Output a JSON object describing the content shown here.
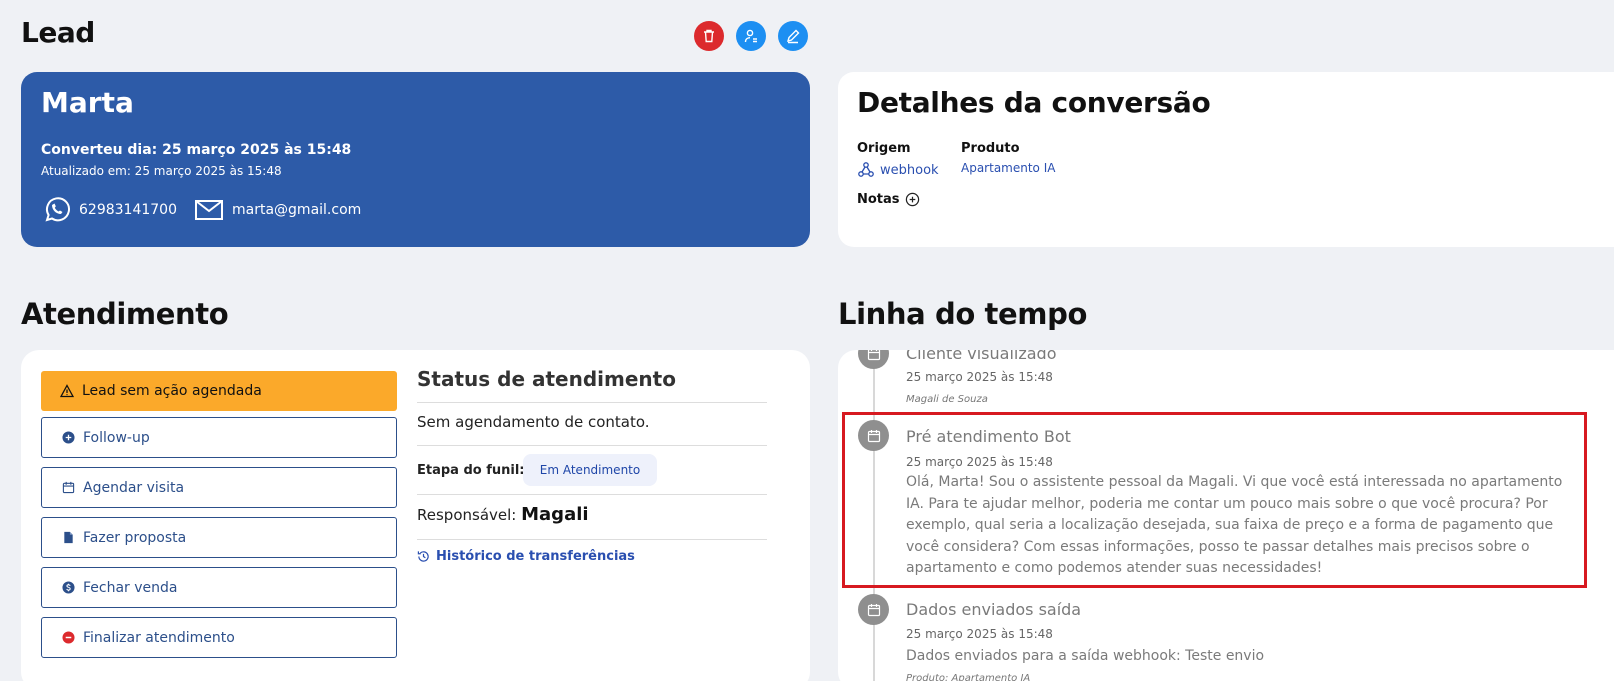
{
  "page": {
    "title": "Lead"
  },
  "header_actions": {
    "icons": [
      "trash-icon",
      "user-assign-icon",
      "pencil-icon"
    ],
    "colors": {
      "delete": "#dc2a2d",
      "primary": "#1d8ff2"
    }
  },
  "lead": {
    "name": "Marta",
    "converted": "Converteu dia: 25 março 2025 às 15:48",
    "updated": "Atualizado em: 25 março 2025 às 15:48",
    "phone": "62983141700",
    "email": "marta@gmail.com",
    "card_color": "#2d5ba8"
  },
  "details": {
    "title": "Detalhes da conversão",
    "origem_label": "Origem",
    "origem_value": "webhook",
    "produto_label": "Produto",
    "produto_value": "Apartamento IA",
    "notas_label": "Notas"
  },
  "atendimento": {
    "title": "Atendimento",
    "alert": "Lead sem ação agendada",
    "actions": [
      {
        "label": "Follow-up",
        "icon": "plus-circle-icon"
      },
      {
        "label": "Agendar visita",
        "icon": "calendar-icon"
      },
      {
        "label": "Fazer proposta",
        "icon": "document-icon"
      },
      {
        "label": "Fechar venda",
        "icon": "dollar-circle-icon"
      },
      {
        "label": "Finalizar atendimento",
        "icon": "minus-circle-icon"
      }
    ],
    "status_title": "Status de atendimento",
    "status_text": "Sem agendamento de contato.",
    "etapa_label": "Etapa do funil:",
    "etapa_value": "Em Atendimento",
    "responsavel_label": "Responsável:",
    "responsavel_name": "Magali",
    "historico_link": "Histórico de transferências"
  },
  "timeline": {
    "title": "Linha do tempo",
    "events": [
      {
        "title": "Cliente visualizado",
        "date": "25 março 2025 às 15:48",
        "author": "Magali de Souza"
      },
      {
        "title": "Pré atendimento Bot",
        "date": "25 março 2025 às 15:48",
        "body": "Olá, Marta! Sou o assistente pessoal da Magali. Vi que você está interessada no apartamento IA. Para te ajudar melhor, poderia me contar um pouco mais sobre o que você procura? Por exemplo, qual seria a localização desejada, sua faixa de preço e a forma de pagamento que você considera? Com essas informações, posso te passar detalhes mais precisos sobre o apartamento e como podemos atender suas necessidades!"
      },
      {
        "title": "Dados enviados saída",
        "date": "25 março 2025 às 15:48",
        "body": "Dados enviados para a saída webhook: Teste envio",
        "author": "Produto: Apartamento IA"
      }
    ]
  }
}
